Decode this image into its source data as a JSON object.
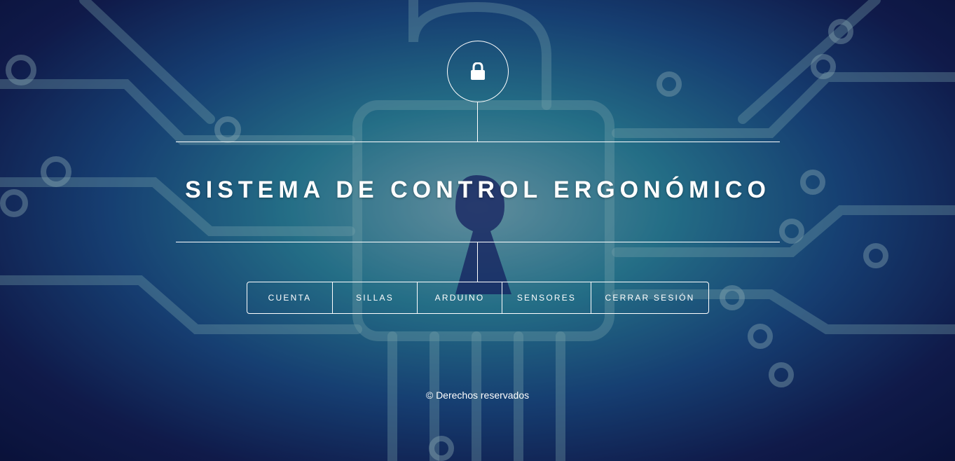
{
  "header": {
    "logo_icon": "lock-icon",
    "title": "SISTEMA DE CONTROL ERGONÓMICO"
  },
  "nav": {
    "items": [
      {
        "label": "CUENTA"
      },
      {
        "label": "SILLAS"
      },
      {
        "label": "ARDUINO"
      },
      {
        "label": "SENSORES"
      },
      {
        "label": "CERRAR SESIÓN"
      }
    ]
  },
  "footer": {
    "text": "© Derechos reservados"
  },
  "colors": {
    "text": "#ffffff",
    "background_dark": "#0c1440",
    "background_teal": "#2f8fa6"
  }
}
